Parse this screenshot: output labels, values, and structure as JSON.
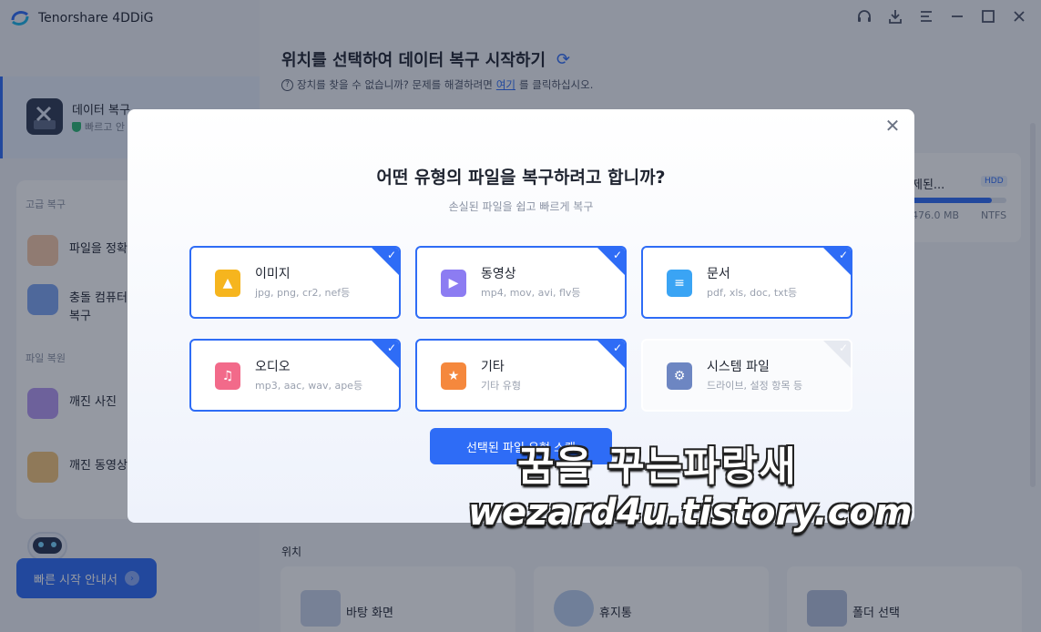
{
  "app": {
    "name": "Tenorshare 4DDiG"
  },
  "sidebar": {
    "recovery": {
      "title": "데이터 복구",
      "subtitle": "빠르고 안"
    },
    "advanced_label": "고급 복구",
    "advanced_items": [
      {
        "label": "파일을 정확"
      },
      {
        "label": "충돌 컴퓨터\n복구"
      }
    ],
    "repair_label": "파일 복원",
    "repair_items": [
      {
        "label": "깨진 사진"
      },
      {
        "label": "깨진 동영상"
      }
    ],
    "quick_start": "빠른 시작 안내서"
  },
  "main": {
    "title": "위치를 선택하여 데이터 복구 시작하기",
    "hint_before": "장치를 찾을 수 없습니까? 문제를 해결하려면",
    "hint_link": "여기",
    "hint_after": "를 클릭하십시오.",
    "disk": {
      "name": "제된...",
      "badge": "HDD",
      "size": "476.0 MB",
      "fs": "NTFS",
      "usage": 0.85
    },
    "location_label": "위치",
    "locations": [
      {
        "label": "바탕 화면"
      },
      {
        "label": "휴지통"
      },
      {
        "label": "폴더 선택"
      }
    ]
  },
  "modal": {
    "title": "어떤 유형의 파일을 복구하려고 합니까?",
    "subtitle": "손실된 파일을 쉽고 빠르게 복구",
    "file_types": [
      {
        "name": "이미지",
        "desc": "jpg, png, cr2, nef등",
        "icon": "image-icon",
        "color": "#f6b51e",
        "checked": true
      },
      {
        "name": "동영상",
        "desc": "mp4, mov, avi, flv등",
        "icon": "video-icon",
        "color": "#8c7cf2",
        "checked": true
      },
      {
        "name": "문서",
        "desc": "pdf, xls, doc, txt등",
        "icon": "document-icon",
        "color": "#3aa4f4",
        "checked": true
      },
      {
        "name": "오디오",
        "desc": "mp3, aac, wav, ape등",
        "icon": "audio-icon",
        "color": "#f26a8a",
        "checked": true
      },
      {
        "name": "기타",
        "desc": "기타 유형",
        "icon": "star-icon",
        "color": "#f5883d",
        "checked": true
      },
      {
        "name": "시스템 파일",
        "desc": "드라이브, 설정 항목 등",
        "icon": "gear-icon",
        "color": "#6d86c2",
        "checked": false
      }
    ],
    "scan_button": "선택된 파일 유형 스캔"
  },
  "watermark": {
    "line1": "꿈을 꾸는파랑새",
    "line2": "wezard4u.tistory.com"
  }
}
